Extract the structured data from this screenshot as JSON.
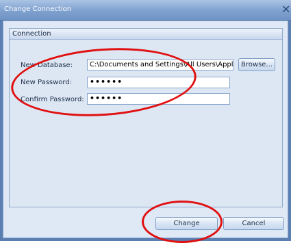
{
  "window": {
    "title": "Change Connection",
    "close_glyph": "✕"
  },
  "group": {
    "title": "Connection"
  },
  "fields": {
    "new_database_label": "New Database:",
    "new_database_value": "C:\\Documents and Settings\\All Users\\Applic",
    "new_password_label": "New Password:",
    "new_password_value": "••••••",
    "confirm_password_label": "Confirm Password:",
    "confirm_password_value": "••••••"
  },
  "buttons": {
    "browse": "Browse...",
    "change": "Change",
    "cancel": "Cancel"
  },
  "colors": {
    "annotation": "#e01010",
    "accent": "#7fa1cf"
  },
  "icons": {
    "close": "close-icon"
  }
}
